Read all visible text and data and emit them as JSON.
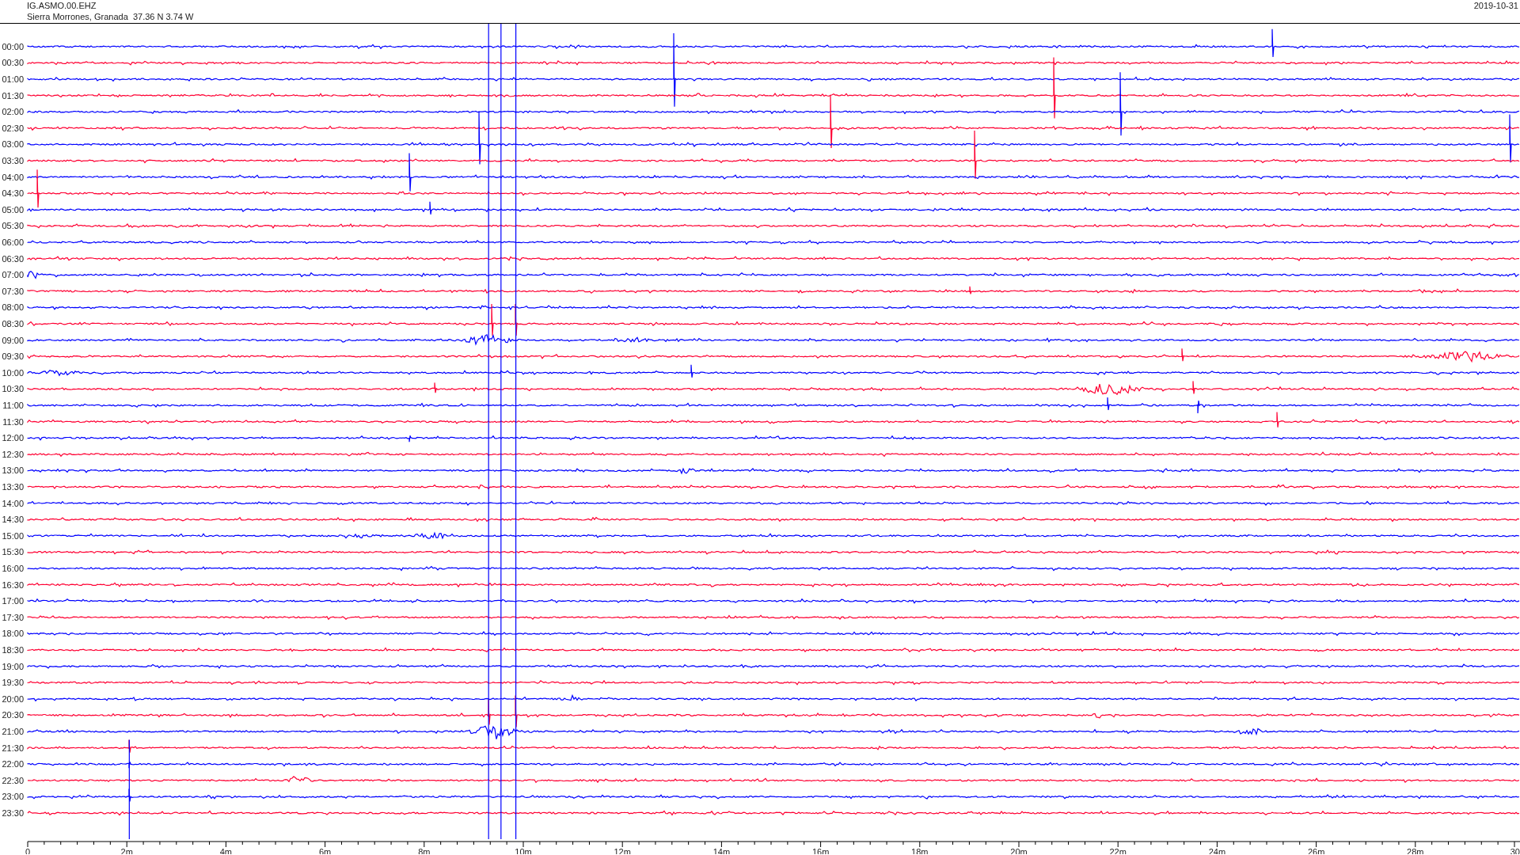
{
  "header": {
    "station": "IG.ASMO.00.EHZ",
    "location": "Sierra Morrones, Granada  37.36 N 3.74 W",
    "date": "2019-10-31"
  },
  "rows": [
    {
      "time": "00:00",
      "color": "#0000ff"
    },
    {
      "time": "00:30",
      "color": "#ff0033"
    },
    {
      "time": "01:00",
      "color": "#0000ff"
    },
    {
      "time": "01:30",
      "color": "#ff0033"
    },
    {
      "time": "02:00",
      "color": "#0000ff"
    },
    {
      "time": "02:30",
      "color": "#ff0033"
    },
    {
      "time": "03:00",
      "color": "#0000ff"
    },
    {
      "time": "03:30",
      "color": "#ff0033"
    },
    {
      "time": "04:00",
      "color": "#0000ff"
    },
    {
      "time": "04:30",
      "color": "#ff0033"
    },
    {
      "time": "05:00",
      "color": "#0000ff"
    },
    {
      "time": "05:30",
      "color": "#ff0033"
    },
    {
      "time": "06:00",
      "color": "#0000ff"
    },
    {
      "time": "06:30",
      "color": "#ff0033"
    },
    {
      "time": "07:00",
      "color": "#0000ff"
    },
    {
      "time": "07:30",
      "color": "#ff0033"
    },
    {
      "time": "08:00",
      "color": "#0000ff"
    },
    {
      "time": "08:30",
      "color": "#ff0033"
    },
    {
      "time": "09:00",
      "color": "#0000ff"
    },
    {
      "time": "09:30",
      "color": "#ff0033"
    },
    {
      "time": "10:00",
      "color": "#0000ff"
    },
    {
      "time": "10:30",
      "color": "#ff0033"
    },
    {
      "time": "11:00",
      "color": "#0000ff"
    },
    {
      "time": "11:30",
      "color": "#ff0033"
    },
    {
      "time": "12:00",
      "color": "#0000ff"
    },
    {
      "time": "12:30",
      "color": "#ff0033"
    },
    {
      "time": "13:00",
      "color": "#0000ff"
    },
    {
      "time": "13:30",
      "color": "#ff0033"
    },
    {
      "time": "14:00",
      "color": "#0000ff"
    },
    {
      "time": "14:30",
      "color": "#ff0033"
    },
    {
      "time": "15:00",
      "color": "#0000ff"
    },
    {
      "time": "15:30",
      "color": "#ff0033"
    },
    {
      "time": "16:00",
      "color": "#0000ff"
    },
    {
      "time": "16:30",
      "color": "#ff0033"
    },
    {
      "time": "17:00",
      "color": "#0000ff"
    },
    {
      "time": "17:30",
      "color": "#ff0033"
    },
    {
      "time": "18:00",
      "color": "#0000ff"
    },
    {
      "time": "18:30",
      "color": "#ff0033"
    },
    {
      "time": "19:00",
      "color": "#0000ff"
    },
    {
      "time": "19:30",
      "color": "#ff0033"
    },
    {
      "time": "20:00",
      "color": "#0000ff"
    },
    {
      "time": "20:30",
      "color": "#ff0033"
    },
    {
      "time": "21:00",
      "color": "#0000ff"
    },
    {
      "time": "21:30",
      "color": "#ff0033"
    },
    {
      "time": "22:00",
      "color": "#0000ff"
    },
    {
      "time": "22:30",
      "color": "#ff0033"
    },
    {
      "time": "23:00",
      "color": "#0000ff"
    },
    {
      "time": "23:30",
      "color": "#ff0033"
    }
  ],
  "x_axis": {
    "labels": [
      "0",
      "2m",
      "4m",
      "6m",
      "8m",
      "10m",
      "12m",
      "14m",
      "16m",
      "18m",
      "20m",
      "22m",
      "24m",
      "26m",
      "28m",
      "30"
    ]
  }
}
